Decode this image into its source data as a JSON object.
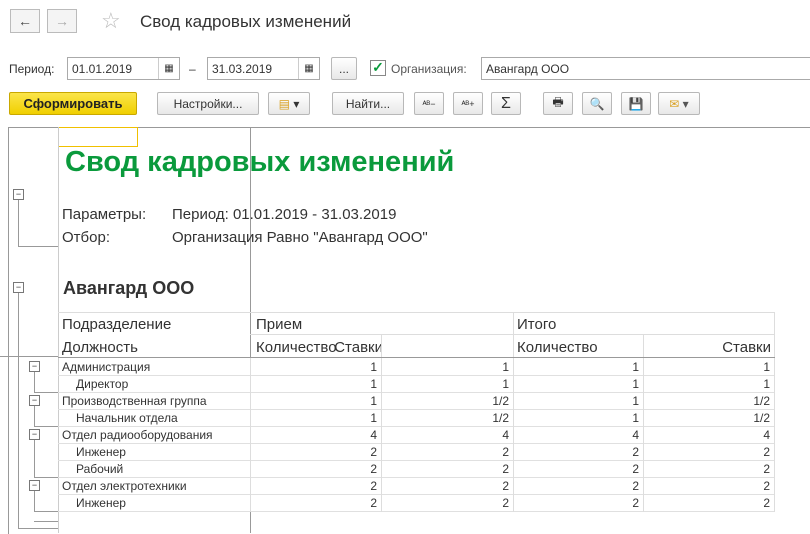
{
  "title": "Свод кадровых изменений",
  "filters": {
    "period_label": "Период:",
    "date_from": "01.01.2019",
    "dash": "–",
    "date_to": "31.03.2019",
    "more": "...",
    "org_label": "Организация:",
    "org_value": "Авангард ООО",
    "org_checked": true
  },
  "toolbar": {
    "generate": "Сформировать",
    "settings": "Настройки...",
    "find": "Найти...",
    "sum": "Σ"
  },
  "report": {
    "title": "Свод кадровых изменений",
    "params_label": "Параметры:",
    "params_value": "Период: 01.01.2019 - 31.03.2019",
    "filter_label": "Отбор:",
    "filter_value": "Организация Равно \"Авангард ООО\"",
    "org": "Авангард ООО",
    "headers": {
      "dept": "Подразделение",
      "position": "Должность",
      "hire": "Прием",
      "total": "Итого",
      "qty1": "Количество",
      "rate1": "Ставки",
      "qty2": "Количество",
      "rate2": "Ставки"
    },
    "rows": [
      {
        "name": "Администрация",
        "group": true,
        "v": [
          "1",
          "1",
          "1",
          "1"
        ]
      },
      {
        "name": "Директор",
        "group": false,
        "v": [
          "1",
          "1",
          "1",
          "1"
        ]
      },
      {
        "name": "Производственная группа",
        "group": true,
        "v": [
          "1",
          "1/2",
          "1",
          "1/2"
        ]
      },
      {
        "name": "Начальник отдела",
        "group": false,
        "v": [
          "1",
          "1/2",
          "1",
          "1/2"
        ]
      },
      {
        "name": "Отдел радиооборудования",
        "group": true,
        "v": [
          "4",
          "4",
          "4",
          "4"
        ]
      },
      {
        "name": "Инженер",
        "group": false,
        "v": [
          "2",
          "2",
          "2",
          "2"
        ]
      },
      {
        "name": "Рабочий",
        "group": false,
        "v": [
          "2",
          "2",
          "2",
          "2"
        ]
      },
      {
        "name": "Отдел электротехники",
        "group": true,
        "v": [
          "2",
          "2",
          "2",
          "2"
        ]
      },
      {
        "name": "Инженер",
        "group": false,
        "v": [
          "2",
          "2",
          "2",
          "2"
        ]
      }
    ]
  },
  "colors": {
    "title_green": "#0a9a3c",
    "generate_bg": "#f5d800"
  }
}
